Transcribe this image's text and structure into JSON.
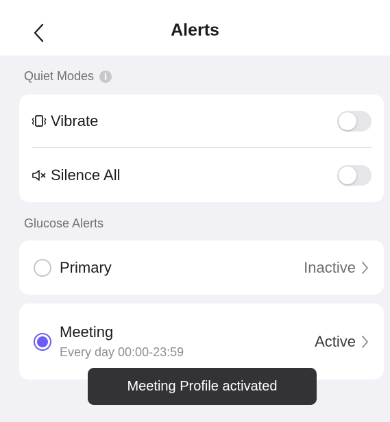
{
  "header": {
    "title": "Alerts",
    "back_icon": "chevron-left-icon"
  },
  "quiet_modes": {
    "label": "Quiet Modes",
    "info_glyph": "i",
    "items": [
      {
        "label": "Vibrate",
        "icon": "vibrate-icon",
        "enabled": false
      },
      {
        "label": "Silence All",
        "icon": "speaker-mute-icon",
        "enabled": false
      }
    ]
  },
  "glucose_alerts": {
    "label": "Glucose Alerts",
    "profiles": [
      {
        "name": "Primary",
        "schedule": "",
        "status": "Inactive",
        "selected": false
      },
      {
        "name": "Meeting",
        "schedule": "Every day 00:00-23:59",
        "status": "Active",
        "selected": true
      }
    ]
  },
  "toast": {
    "message": "Meeting Profile activated"
  },
  "colors": {
    "accent": "#6a5cf5",
    "toggle_off": "#e5e5ea",
    "background": "#f2f2f6"
  }
}
